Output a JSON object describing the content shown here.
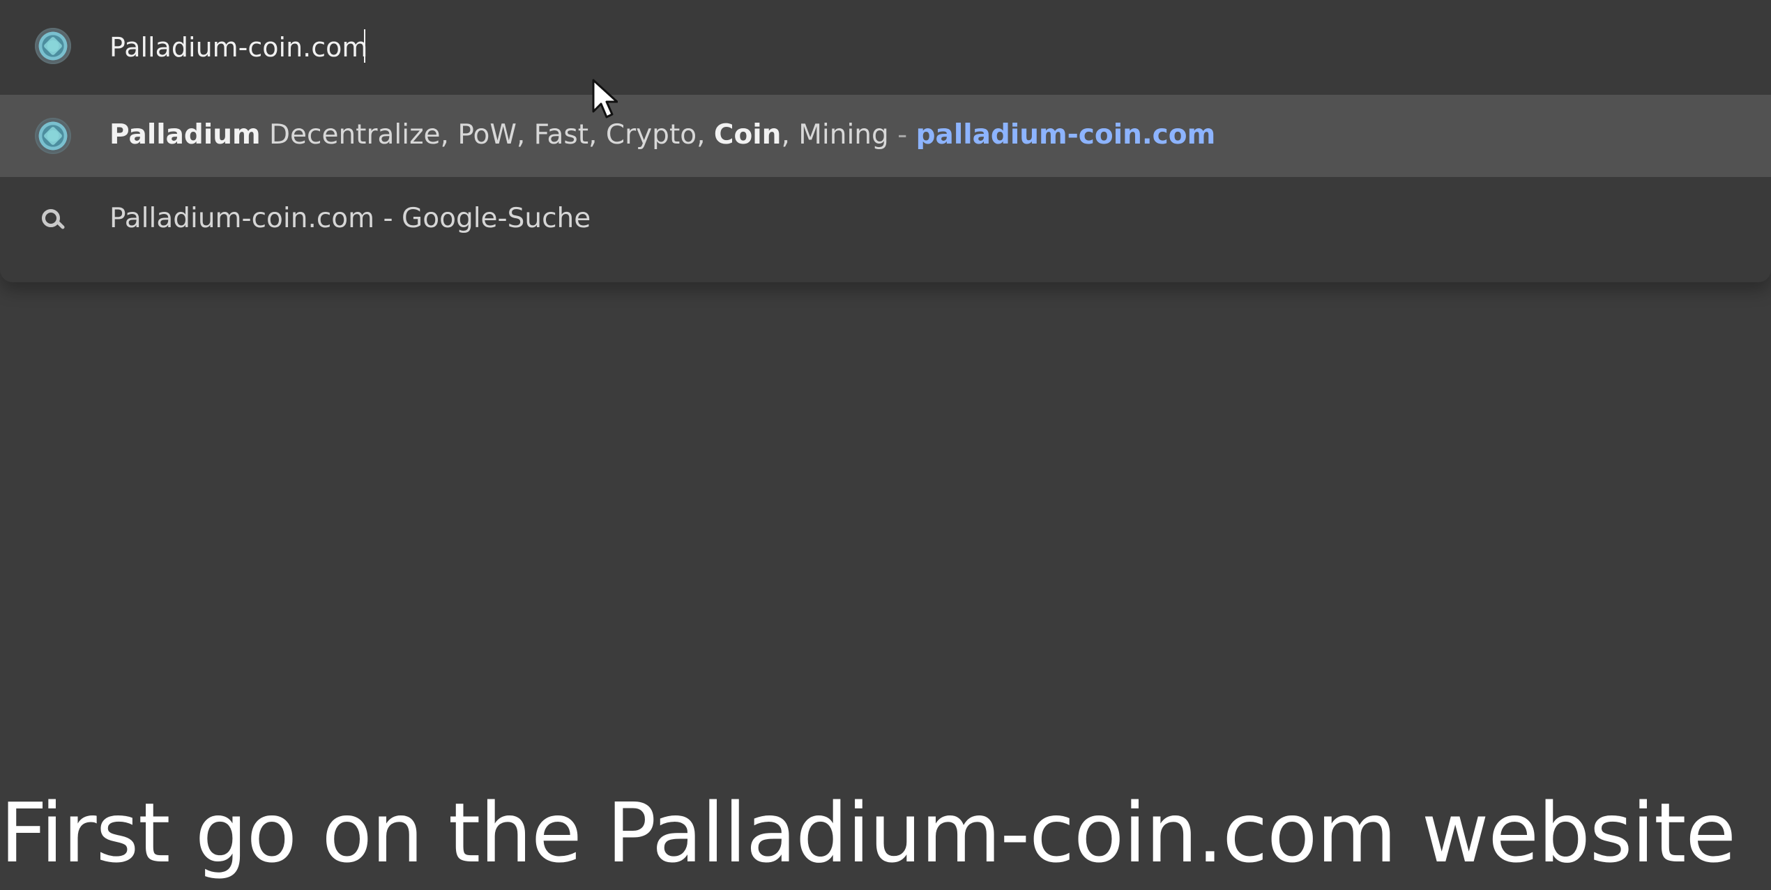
{
  "omnibox": {
    "input_value": "Palladium-coin.com",
    "site_icon": "palladium-site-icon",
    "suggestions": [
      {
        "type": "site",
        "icon": "palladium-site-icon",
        "title_bold_1": "Palladium",
        "title_mid_1": " Decentralize, PoW, Fast, Crypto, ",
        "title_bold_2": "Coin",
        "title_mid_2": ", Mining",
        "separator": " - ",
        "url": "palladium-coin.com"
      },
      {
        "type": "search",
        "icon": "search-icon",
        "text": "Palladium-coin.com - Google-Suche"
      }
    ]
  },
  "overlay": {
    "caption": "First go on the Palladium-coin.com website"
  },
  "colors": {
    "background": "#3c3c3c",
    "dropdown": "#3a3a3a",
    "selected_suggestion": "#525252",
    "url_link": "#8db4ff",
    "text_primary": "#f2f2f2"
  }
}
